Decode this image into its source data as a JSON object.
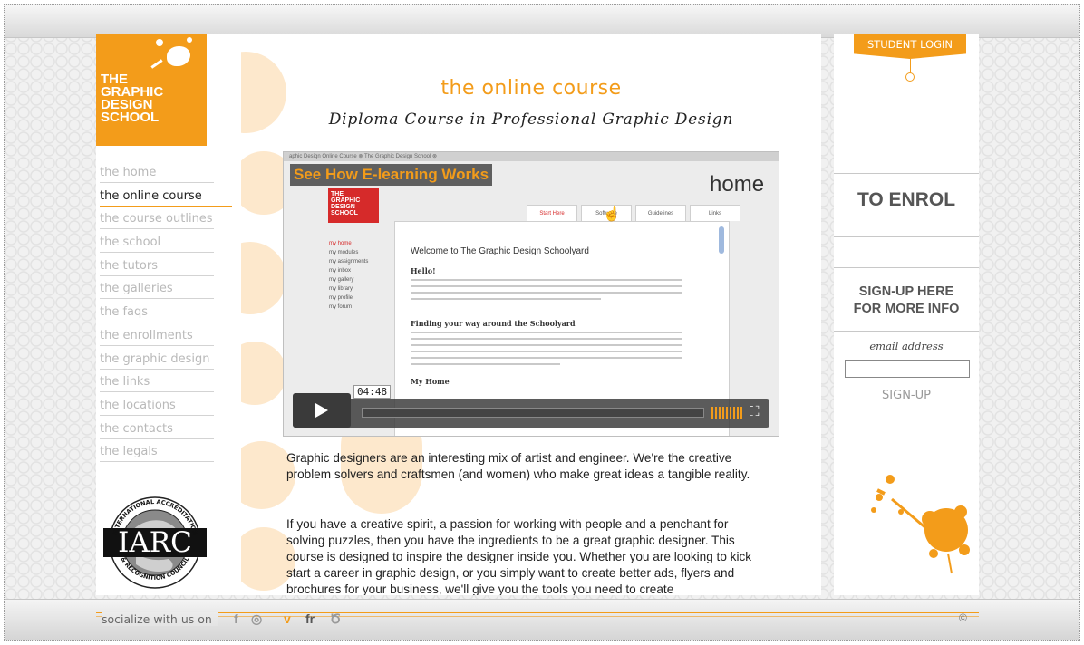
{
  "site": {
    "logo_text": "THE\nGRAPHIC\nDESIGN\nSCHOOL",
    "brand_color": "#f39c1a"
  },
  "nav": {
    "items": [
      {
        "label": "the home"
      },
      {
        "label": "the online course",
        "active": true
      },
      {
        "label": "the course outlines"
      },
      {
        "label": "the school"
      },
      {
        "label": "the tutors"
      },
      {
        "label": "the galleries"
      },
      {
        "label": "the faqs"
      },
      {
        "label": "the enrollments"
      },
      {
        "label": "the graphic design"
      },
      {
        "label": "the links"
      },
      {
        "label": "the locations"
      },
      {
        "label": "the contacts"
      },
      {
        "label": "the legals"
      }
    ]
  },
  "seal": {
    "acronym": "IARC",
    "ring_top": "INTERNATIONAL ACCREDITATION",
    "ring_bottom": "& RECOGNITION COUNCIL"
  },
  "main": {
    "title": "the online course",
    "subtitle": "Diploma Course in Professional Graphic Design",
    "video": {
      "tab_strip": "aphic Design Online Course   ⊗   The Graphic Design School   ⊗",
      "heading": "See How E-learning Works",
      "logo_text": "THE\nGRAPHIC\nDESIGN\nSCHOOL",
      "page_title": "home",
      "tabs": [
        "Start Here",
        "Software",
        "Guidelines",
        "Links"
      ],
      "menu": [
        "my home",
        "my modules",
        "my assignments",
        "my inbox",
        "my gallery",
        "my library",
        "my profile",
        "my forum"
      ],
      "welcome": "Welcome to The Graphic Design Schoolyard",
      "h_hello": "Hello!",
      "h_finding": "Finding your way around the Schoolyard",
      "h_myhome": "My Home",
      "time": "04:48"
    },
    "paragraphs": [
      "Graphic designers are an interesting mix of artist and engineer. We're the creative problem solvers and craftsmen (and women) who make great ideas a tangible reality.",
      "If you have a creative spirit, a passion for working with people and a penchant for solving puzzles, then you have the ingredients to be a great graphic designer. This course is designed to inspire the designer inside you. Whether you are looking to kick start a career in graphic design, or you simply want to create better ads, flyers and brochures for your business, we'll give you the tools you need to create"
    ]
  },
  "right": {
    "login_label": "STUDENT LOGIN",
    "enrol_label": "TO ENROL",
    "signup_title": "SIGN-UP HERE\nFOR MORE INFO",
    "email_label": "email address",
    "email_value": "",
    "signup_button": "SIGN-UP"
  },
  "footer": {
    "socialize": "socialize with us on",
    "icons": [
      "facebook-icon",
      "instagram-icon",
      "vimeo-icon",
      "flickr-icon",
      "owl-icon"
    ],
    "icon_glyphs": [
      "f",
      "◎",
      "v",
      "fr",
      "Ծ"
    ],
    "copyright": "©"
  }
}
